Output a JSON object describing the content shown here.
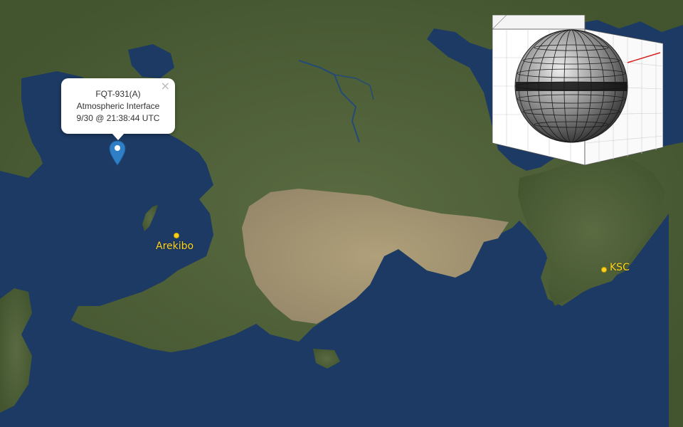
{
  "map": {
    "colors": {
      "ocean": "#1c3a63",
      "land_green": "#4d5f39",
      "land_desert": "#a99a74",
      "marker_blue": "#2f7fc7",
      "place_yellow": "#ffd21f"
    },
    "places": [
      {
        "name": "Arekibo",
        "icon": "place-dot-icon"
      },
      {
        "name": "KSC",
        "icon": "place-dot-icon"
      }
    ]
  },
  "popup": {
    "line1": "FQT-931(A)",
    "line2": "Atmospheric Interface",
    "line3": "9/30 @ 21:38:44 UTC",
    "close_glyph": "×",
    "close_icon": "close-icon"
  },
  "marker": {
    "icon": "map-pin-icon",
    "color": "#2f7fc7"
  },
  "globe": {
    "icon": "wireframe-globe-icon",
    "axis_color": "#d62020"
  }
}
